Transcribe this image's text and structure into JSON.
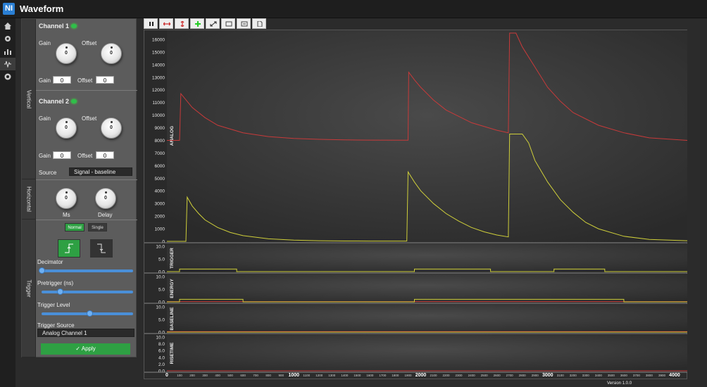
{
  "app": {
    "title": "Waveform",
    "logo_text": "NI",
    "version": "Version 1.0.0"
  },
  "nav": [
    {
      "icon": "home-icon"
    },
    {
      "icon": "gear-icon"
    },
    {
      "icon": "bar-chart-icon"
    },
    {
      "icon": "waveform-icon"
    },
    {
      "icon": "settings-icon"
    }
  ],
  "vertical": {
    "tab_label": "Vertical",
    "channel1": {
      "title": "Channel 1",
      "gain_label": "Gain",
      "offset_label": "Offset",
      "gain_knob": "0",
      "offset_knob": "0",
      "gain_value": "0",
      "offset_value": "0"
    },
    "channel2": {
      "title": "Channel 2",
      "gain_label": "Gain",
      "offset_label": "Offset",
      "gain_knob": "0",
      "offset_knob": "0",
      "gain_value": "0",
      "offset_value": "0"
    },
    "source_label": "Source",
    "source_value": "Signal - baseline"
  },
  "horizontal": {
    "tab_label": "Horizontal",
    "ms_label": "Ms",
    "delay_label": "Delay",
    "ms_knob": "0",
    "delay_knob": "0"
  },
  "trigger": {
    "tab_label": "Trigger",
    "normal_label": "Normal",
    "single_label": "Single",
    "decimator_label": "Decimator",
    "pretrigger_label": "Pretrigger (ns)",
    "level_label": "Trigger Level",
    "source_label": "Trigger Source",
    "source_value": "Analog Channel 1",
    "apply_label": "Apply",
    "apply_icon": "check-icon",
    "decimator_pos": 0.0,
    "pretrigger_pos": 0.2,
    "level_pos": 0.52
  },
  "toolbar": [
    "pause-icon",
    "zoom-x-icon",
    "zoom-y-icon",
    "pan-icon",
    "autoscale-icon",
    "save-icon",
    "export-icon",
    "file-icon"
  ],
  "colors": {
    "ch1": "#c83a3a",
    "ch2": "#cfcf3a",
    "accent": "#2ea043",
    "plot_bg": "#2c2c2c"
  },
  "chart_data": {
    "type": "line",
    "x_ticks_major": [
      "0",
      "1000",
      "2000",
      "3000",
      "4000"
    ],
    "x_ticks_minor": [
      "100",
      "200",
      "300",
      "400",
      "500",
      "600",
      "700",
      "800",
      "900",
      "1100",
      "1200",
      "1300",
      "1400",
      "1500",
      "1600",
      "1700",
      "1800",
      "1900",
      "2100",
      "2200",
      "2300",
      "2400",
      "2500",
      "2600",
      "2700",
      "2800",
      "2900",
      "3100",
      "3200",
      "3300",
      "3400",
      "3500",
      "3600",
      "3700",
      "3800",
      "3900"
    ],
    "xlim": [
      0,
      4100
    ],
    "panels": [
      {
        "name": "ANALOG",
        "ylim": [
          0,
          16500
        ],
        "yticks": [
          "0",
          "1000",
          "2000",
          "3000",
          "4000",
          "5000",
          "6000",
          "7000",
          "8000",
          "9000",
          "10000",
          "11000",
          "12000",
          "13000",
          "14000",
          "15000",
          "16000"
        ],
        "series": [
          {
            "color": "#c83a3a",
            "x": [
              0,
              100,
              110,
              200,
              300,
              400,
              600,
              800,
              1000,
              1200,
              1400,
              1600,
              1900,
              1905,
              1950,
              2000,
              2100,
              2200,
              2400,
              2600,
              2690,
              2700,
              2750,
              2800,
              2900,
              3000,
              3100,
              3200,
              3400,
              3600,
              3800,
              4100
            ],
            "y": [
              8000,
              8000,
              11700,
              10600,
              9800,
              9200,
              8600,
              8300,
              8150,
              8080,
              8040,
              8020,
              8010,
              13400,
              12800,
              12200,
              11200,
              10400,
              9400,
              8800,
              8600,
              16500,
              16500,
              15400,
              13800,
              12200,
              11100,
              10200,
              9200,
              8600,
              8200,
              8000
            ]
          },
          {
            "color": "#cfcf3a",
            "x": [
              0,
              150,
              160,
              200,
              250,
              300,
              400,
              500,
              600,
              800,
              1000,
              1200,
              1400,
              1600,
              1890,
              1900,
              1950,
              2000,
              2100,
              2200,
              2300,
              2400,
              2500,
              2600,
              2690,
              2700,
              2800,
              2850,
              2900,
              3000,
              3100,
              3200,
              3300,
              3400,
              3600,
              3800,
              4100
            ],
            "y": [
              0,
              0,
              3500,
              2800,
              2200,
              1700,
              1100,
              700,
              450,
              200,
              100,
              50,
              30,
              20,
              20,
              5500,
              4700,
              4000,
              3000,
              2200,
              1600,
              1100,
              750,
              500,
              350,
              8500,
              8500,
              7800,
              6400,
              4700,
              3300,
              2300,
              1500,
              1000,
              400,
              150,
              50
            ]
          }
        ]
      },
      {
        "name": "TRIGGER",
        "ylim": [
          0,
          10
        ],
        "yticks": [
          "0.0",
          "5.0",
          "10.0"
        ],
        "series": [
          {
            "color": "#cfcf3a",
            "x": [
              0,
              100,
              100,
              550,
              550,
              1950,
              1950,
              2550,
              2550,
              3050,
              3050,
              3450,
              3450,
              4100
            ],
            "y": [
              0,
              0,
              1,
              1,
              0,
              0,
              1,
              1,
              0,
              0,
              1,
              1,
              0,
              0
            ]
          }
        ]
      },
      {
        "name": "ENERGY",
        "ylim": [
          0,
          10
        ],
        "yticks": [
          "0.0",
          "5.0",
          "10.0"
        ],
        "series": [
          {
            "color": "#c83a3a",
            "x": [
              0,
              4100
            ],
            "y": [
              0.1,
              0.1
            ]
          },
          {
            "color": "#cfcf3a",
            "x": [
              0,
              100,
              100,
              600,
              600,
              1950,
              1950,
              3600,
              3600,
              4100
            ],
            "y": [
              0,
              0,
              1,
              1,
              0,
              0,
              1,
              1,
              0,
              0
            ]
          }
        ]
      },
      {
        "name": "BASELINE",
        "ylim": [
          0,
          10
        ],
        "yticks": [
          "0.0",
          "5.0",
          "10.0"
        ],
        "series": [
          {
            "color": "#c83a3a",
            "x": [
              0,
              4100
            ],
            "y": [
              0.2,
              0.2
            ]
          },
          {
            "color": "#cfcf3a",
            "x": [
              0,
              4100
            ],
            "y": [
              0,
              0
            ]
          }
        ]
      },
      {
        "name": "RISETIME",
        "ylim": [
          0,
          10
        ],
        "yticks": [
          "0.0",
          "2.0",
          "4.0",
          "6.0",
          "8.0",
          "10.0"
        ],
        "series": [
          {
            "color": "#c83a3a",
            "x": [
              0,
              4100
            ],
            "y": [
              0,
              0
            ]
          }
        ]
      }
    ]
  }
}
